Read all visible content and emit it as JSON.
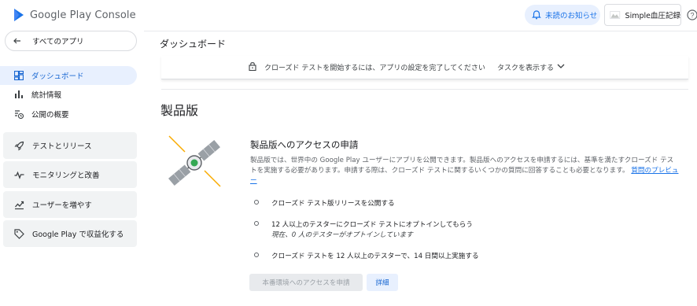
{
  "header": {
    "brand": "Google Play Console",
    "notifications_label": "未読のお知らせ",
    "app_name": "Simple血圧記録"
  },
  "sidebar": {
    "back_label": "すべてのアプリ",
    "items": [
      {
        "label": "ダッシュボード",
        "icon": "dashboard-icon"
      },
      {
        "label": "統計情報",
        "icon": "bar-chart-icon"
      },
      {
        "label": "公開の概要",
        "icon": "publish-clock-icon"
      }
    ],
    "sections": [
      {
        "label": "テストとリリース",
        "icon": "rocket-icon"
      },
      {
        "label": "モニタリングと改善",
        "icon": "pulse-icon"
      },
      {
        "label": "ユーザーを増やす",
        "icon": "growth-icon"
      },
      {
        "label": "Google Play で収益化する",
        "icon": "tag-icon"
      }
    ]
  },
  "main": {
    "page_title": "ダッシュボード",
    "banner": {
      "message": "クローズド テストを開始するには、アプリの設定を完了してください",
      "task_label": "タスクを表示する"
    },
    "section_title": "製品版",
    "card": {
      "title": "製品版へのアクセスの申請",
      "description": "製品版では、世界中の Google Play ユーザーにアプリを公開できます。製品版へのアクセスを申請するには、基準を満たすクローズド テストを実施する必要があります。申請する際は、クローズド テストに関するいくつかの質問に回答することも必要となります。",
      "link": "質問のプレビュー",
      "requirements": [
        {
          "text": "クローズド テスト版リリースを公開する",
          "sub": ""
        },
        {
          "text": "12 人以上のテスターにクローズド テストにオプトインしてもらう",
          "sub": "現在、0 人のテスターがオプトインしています"
        },
        {
          "text": "クローズド テストを 12 人以上のテスターで、14 日間以上実施する",
          "sub": ""
        }
      ],
      "apply_button": "本番環境へのアクセスを申請",
      "details_button": "詳細"
    }
  },
  "colors": {
    "accent": "#1a73e8",
    "active_bg": "#e8f0fe",
    "section_bg": "#f1f3f4"
  }
}
